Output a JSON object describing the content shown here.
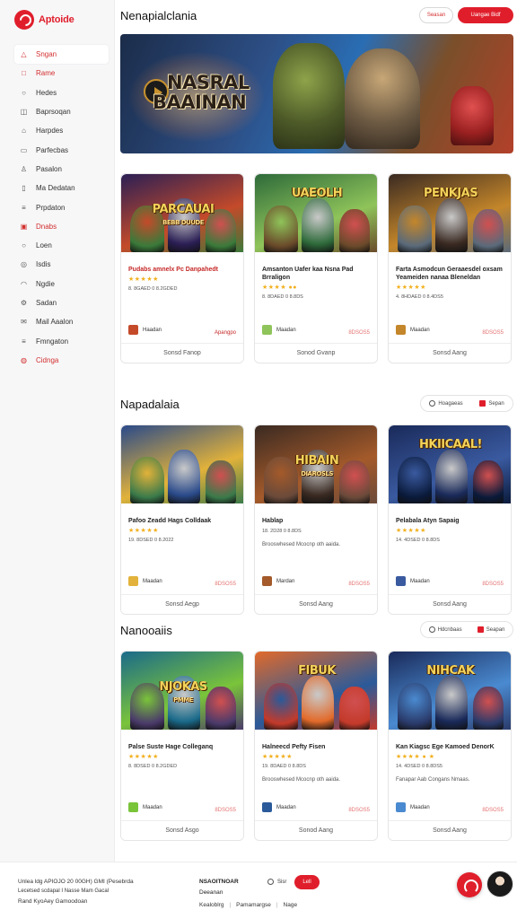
{
  "app": {
    "logo_text": "Aptoide"
  },
  "sidebar": {
    "items": [
      {
        "label": "Sngan",
        "icon": "triangle-icon",
        "state": "active"
      },
      {
        "label": "Rame",
        "icon": "square-icon",
        "state": "red"
      },
      {
        "label": "Hedes",
        "icon": "circle-icon"
      },
      {
        "label": "Baprsoqan",
        "icon": "bag-icon"
      },
      {
        "label": "Harpdes",
        "icon": "home-icon"
      },
      {
        "label": "Parfecbas",
        "icon": "rectangle-icon"
      },
      {
        "label": "Pasalon",
        "icon": "person-icon"
      },
      {
        "label": "Ma Dedatan",
        "icon": "document-icon"
      },
      {
        "label": "Prpdaton",
        "icon": "list-icon"
      },
      {
        "label": "Dnabs",
        "icon": "box-icon",
        "state": "red"
      },
      {
        "label": "Loen",
        "icon": "circle-icon"
      },
      {
        "label": "Isdis",
        "icon": "ring-icon"
      },
      {
        "label": "Ngdie",
        "icon": "wifi-icon"
      },
      {
        "label": "Sadan",
        "icon": "gear-icon"
      },
      {
        "label": "Mail Aaalon",
        "icon": "mail-icon"
      },
      {
        "label": "Fmngaton",
        "icon": "list-icon"
      },
      {
        "label": "Cidnga",
        "icon": "globe-icon",
        "state": "red"
      }
    ]
  },
  "header": {
    "title": "Nenapialclania",
    "outline_button": "Seasan",
    "solid_button": "Uangae Bidf"
  },
  "hero": {
    "line1": "NASRAL",
    "line2": "BAAINAN"
  },
  "sections": [
    {
      "title": "",
      "cards": [
        {
          "thumb_title": "PARCAUAI",
          "thumb_sub": "BEBB DUUDE",
          "name": "Pudabs amnelx Pc Danpahedt",
          "name_red": true,
          "stars": "★★★★★",
          "meta": "8. 8GAED 0 8.2GDED",
          "desc": "",
          "publisher": "Haadan",
          "price": "Apangpo",
          "price_strong": true,
          "action": "Sonsd Fanop",
          "colors": [
            "#2b1f55",
            "#c44a2a",
            "#3a7a3a"
          ]
        },
        {
          "thumb_title": "UAEOLH",
          "thumb_sub": "",
          "name": "Amsanton Uafer kaa Nsna Pad Brraligon",
          "name_red": false,
          "stars": "★★★★ ●●",
          "meta": "8. 8DAED 0 8.8DS",
          "desc": "",
          "publisher": "Maadan",
          "price": "8DSOS5",
          "price_strong": false,
          "action": "Sonod Gvanp",
          "colors": [
            "#2e6a3a",
            "#8fc45a",
            "#6a4a2a"
          ]
        },
        {
          "thumb_title": "PENKJAS",
          "thumb_sub": "",
          "name": "Farta Asmodcun Geraaesdel oxsam Yeameiden nanaa Bleneldan",
          "name_red": false,
          "stars": "★★★★★",
          "meta": "4. 8HDAED 0 8.4DS5",
          "desc": "",
          "publisher": "Maadan",
          "price": "8DSOS5",
          "price_strong": false,
          "action": "Sonsd Aang",
          "colors": [
            "#3a2a22",
            "#c4862a",
            "#5a6a7a"
          ]
        }
      ]
    },
    {
      "title": "Napadalaia",
      "tool_a": "Hoagaeas",
      "tool_b": "Sepan",
      "cards": [
        {
          "thumb_title": "",
          "thumb_sub": "",
          "name": "Pafoo Zeadd Hags Colldaak",
          "name_red": false,
          "stars": "★★★★★",
          "meta": "19. 8DSED 0 8.2022",
          "desc": "",
          "publisher": "Maadan",
          "price": "8DSOS5",
          "price_strong": false,
          "action": "Sonsd Aegp",
          "colors": [
            "#2a4a8a",
            "#e2b23a",
            "#3a7a4a"
          ]
        },
        {
          "thumb_title": "HIBAIN",
          "thumb_sub": "DIAROSLS",
          "name": "Hablap",
          "name_red": false,
          "stars": "",
          "meta": "18. 2D28 0 8.8DS",
          "desc": "Brooswhesed Mcocnp oth aaida.",
          "publisher": "Mardan",
          "price": "8DSOS5",
          "price_strong": false,
          "action": "Sonsd Aang",
          "colors": [
            "#3a2a22",
            "#a45a2a",
            "#6a4a3a"
          ]
        },
        {
          "thumb_title": "HKIICAAL!",
          "thumb_sub": "",
          "name": "Pelabala Atyn Sapaig",
          "name_red": false,
          "stars": "★★★★★",
          "meta": "14. 4DSED 0 8.8DS",
          "desc": "",
          "publisher": "Maadan",
          "price": "8DSOS5",
          "price_strong": false,
          "action": "Sonsd Aang",
          "colors": [
            "#1a2a5a",
            "#3a5aa0",
            "#0a1a3a"
          ]
        }
      ]
    },
    {
      "title": "Nanooaiis",
      "tool_a": "Hdcnbaas",
      "tool_b": "Seapan",
      "cards": [
        {
          "thumb_title": "NJOKAS",
          "thumb_sub": "PMME",
          "name": "Palse Suste Hage Colleganq",
          "name_red": false,
          "stars": "★★★★★",
          "meta": "8. 8DSED 0 8.2GDED",
          "desc": "",
          "publisher": "Maadan",
          "price": "8DSOS5",
          "price_strong": false,
          "action": "Sonsd Asgo",
          "colors": [
            "#1a6a8a",
            "#7ac43a",
            "#4a3a6a"
          ]
        },
        {
          "thumb_title": "FIBUK",
          "thumb_sub": "",
          "name": "Halneecd Pefty Fisen",
          "name_red": false,
          "stars": "★★★★★",
          "meta": "19. 8DAED 0 8.8DS",
          "desc": "Brooswhesed Mcocnp oth aaida.",
          "publisher": "Maadan",
          "price": "8DSOS5",
          "price_strong": false,
          "action": "Sonod Aang",
          "colors": [
            "#e26a2a",
            "#2a5a9a",
            "#c43a2a"
          ]
        },
        {
          "thumb_title": "NIHCAK",
          "thumb_sub": "",
          "name": "Kan Kiagsc Ege Kamoed DenorK",
          "name_red": false,
          "stars": "★★★★ ● ★",
          "meta": "14. 4DSED 0 8.8DS5",
          "desc": "Fanapar Aab Congans Nmaas.",
          "publisher": "Maadan",
          "price": "8DSOS5",
          "price_strong": false,
          "action": "Sonsd Aang",
          "colors": [
            "#1a2a5a",
            "#4a8ad0",
            "#2a3a6a"
          ]
        }
      ]
    }
  ],
  "footer": {
    "left_line1": "Unlea ldg APIOJO 20 00GH) GMI (Pesebrda",
    "left_line2": "Lecetsed scdapal I Nasse Mam Gacal",
    "left_line3": "Rand KyoAey Gamoodoan",
    "mid_title": "NSAOITNOAR",
    "mid_sub": "Deeanan",
    "links": [
      "Kealoblrg",
      "Pamamargse",
      "Nage"
    ],
    "toggle_label": "Sisr",
    "button_label": "Lell"
  }
}
